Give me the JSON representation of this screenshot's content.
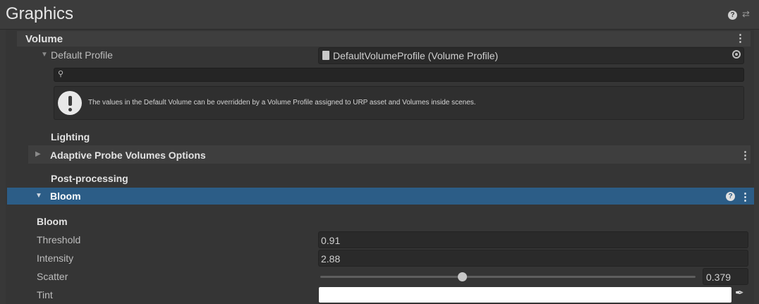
{
  "window": {
    "title": "Graphics"
  },
  "volume": {
    "heading": "Volume",
    "default_profile_label": "Default Profile",
    "default_profile_value": "DefaultVolumeProfile (Volume Profile)",
    "search_placeholder": "",
    "info_text": "The values in the Default Volume can be overridden by a Volume Profile assigned to URP asset and Volumes inside scenes."
  },
  "sections": {
    "lighting": "Lighting",
    "adaptive_probe": "Adaptive Probe Volumes Options",
    "post_processing": "Post-processing"
  },
  "bloom": {
    "header": "Bloom",
    "group_label": "Bloom",
    "threshold_label": "Threshold",
    "threshold_value": "0.91",
    "intensity_label": "Intensity",
    "intensity_value": "2.88",
    "scatter_label": "Scatter",
    "scatter_value": "0.379",
    "scatter_fraction": 0.379,
    "tint_label": "Tint",
    "tint_color": "#ffffff"
  },
  "colors": {
    "accent_selection": "#2c5d87"
  },
  "icons": [
    "help-icon",
    "preset-icon",
    "kebab-menu-icon",
    "foldout-triangle-icon",
    "asset-file-icon",
    "object-picker-icon",
    "search-icon",
    "info-icon",
    "eyedropper-icon"
  ]
}
